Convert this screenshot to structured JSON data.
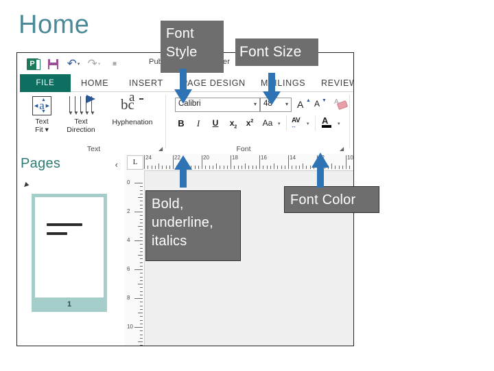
{
  "slide": {
    "title": "Home",
    "title_color": "#4a8a96"
  },
  "app_window": {
    "window_title": "Publication1 - Publisher",
    "quick_access": [
      {
        "name": "publisher-logo-icon",
        "label": "P"
      },
      {
        "name": "save-icon",
        "label": ""
      },
      {
        "name": "undo-icon",
        "label": "↶"
      },
      {
        "name": "redo-icon",
        "label": "↷"
      },
      {
        "name": "customize-quick-access-icon",
        "label": "☰"
      }
    ],
    "tabs": [
      {
        "label": "FILE",
        "active": true
      },
      {
        "label": "HOME",
        "active": false
      },
      {
        "label": "INSERT",
        "active": false
      },
      {
        "label": "PAGE DESIGN",
        "active": false
      },
      {
        "label": "MAILINGS",
        "active": false
      },
      {
        "label": "REVIEW",
        "active": false
      }
    ],
    "ribbon": {
      "text_group": {
        "label": "Text",
        "buttons": [
          {
            "name": "text-fit-button",
            "line1": "Text",
            "line2": "Fit ▾"
          },
          {
            "name": "text-direction-button",
            "line1": "Text",
            "line2": "Direction"
          },
          {
            "name": "hyphenation-button",
            "line1": "Hyphenation",
            "line2": ""
          }
        ]
      },
      "font_group": {
        "label": "Font",
        "font_name": "Calibri",
        "font_size": "48",
        "grow_font": "A",
        "shrink_font": "A",
        "clear_formatting": "A",
        "bold": "B",
        "italic": "I",
        "underline": "U",
        "subscript": "x",
        "subscript_sub": "2",
        "superscript": "x",
        "superscript_sup": "2",
        "change_case": "Aa",
        "character_spacing": "AV",
        "font_color": "A",
        "font_color_swatch": "#000000"
      }
    },
    "pages_pane": {
      "title": "Pages",
      "collapse_label": "‹",
      "page_number": "1"
    },
    "rulers": {
      "tab_selector": "L",
      "horizontal_ticks": [
        "24",
        "22",
        "20",
        "18",
        "16",
        "14",
        "12",
        "10"
      ],
      "vertical_ticks": [
        "0",
        "2",
        "4",
        "6",
        "8",
        "10"
      ]
    }
  },
  "callouts": [
    {
      "name": "callout-font-style",
      "text": "Font Style"
    },
    {
      "name": "callout-font-size",
      "text": "Font Size"
    },
    {
      "name": "callout-bold-underline-italics",
      "text": "Bold, underline, italics"
    },
    {
      "name": "callout-font-color",
      "text": "Font Color"
    }
  ],
  "arrows": [
    {
      "name": "arrow-font-style",
      "direction": "down",
      "color": "#2e74b5"
    },
    {
      "name": "arrow-font-size",
      "direction": "down",
      "color": "#2e74b5"
    },
    {
      "name": "arrow-bold-underline-italics",
      "direction": "up",
      "color": "#2e74b5"
    },
    {
      "name": "arrow-font-color",
      "direction": "up",
      "color": "#2e74b5"
    }
  ]
}
